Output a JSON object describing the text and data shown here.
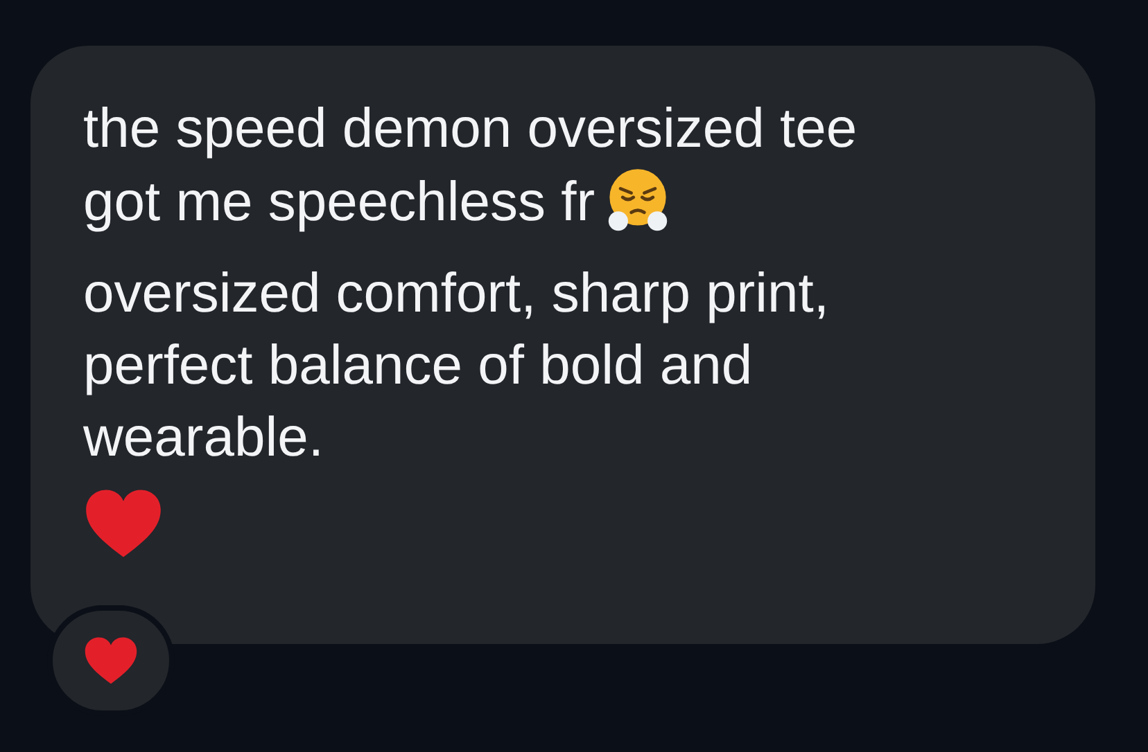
{
  "message": {
    "lines": [
      "the speed demon oversized tee",
      "got me speechless fr"
    ],
    "continued_lines": [
      "oversized comfort, sharp print,",
      "perfect balance of bold and",
      "wearable."
    ]
  }
}
